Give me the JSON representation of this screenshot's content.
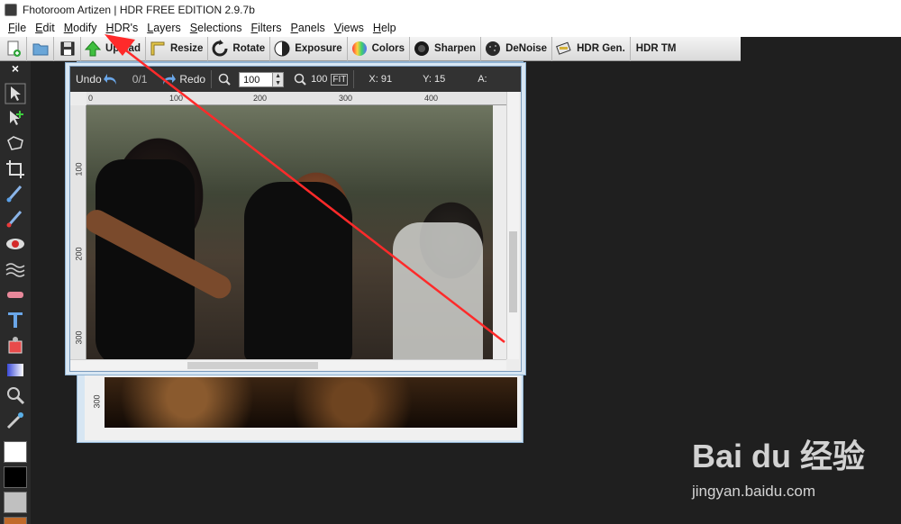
{
  "window": {
    "title": "Fhotoroom Artizen | HDR FREE EDITION 2.9.7b"
  },
  "menu": [
    "File",
    "Edit",
    "Modify",
    "HDR's",
    "Layers",
    "Selections",
    "Filters",
    "Panels",
    "Views",
    "Help"
  ],
  "toolbar": {
    "upload": "Upload",
    "resize": "Resize",
    "rotate": "Rotate",
    "exposure": "Exposure",
    "colors": "Colors",
    "sharpen": "Sharpen",
    "denoise": "DeNoise",
    "hdr_gen": "HDR Gen.",
    "hdr_tm": "HDR TM"
  },
  "palette": {
    "close": "×"
  },
  "document": {
    "undo": "Undo",
    "undo_count": "0/1",
    "redo": "Redo",
    "zoom": "100",
    "zoom_fit": "100",
    "x_label": "X: 91",
    "y_label": "Y: 15",
    "a_label": "A:",
    "ruler_top": [
      "0",
      "100",
      "200",
      "300",
      "400"
    ],
    "ruler_left": [
      "100",
      "200",
      "300"
    ]
  },
  "back_document": {
    "ruler_left": [
      "300"
    ]
  },
  "watermark": {
    "logo": "Bai du 经验",
    "url": "jingyan.baidu.com"
  },
  "colors": {
    "accent_red": "#ff2a2a",
    "doc_border": "#8fb2d2",
    "panel_dark": "#323232"
  }
}
